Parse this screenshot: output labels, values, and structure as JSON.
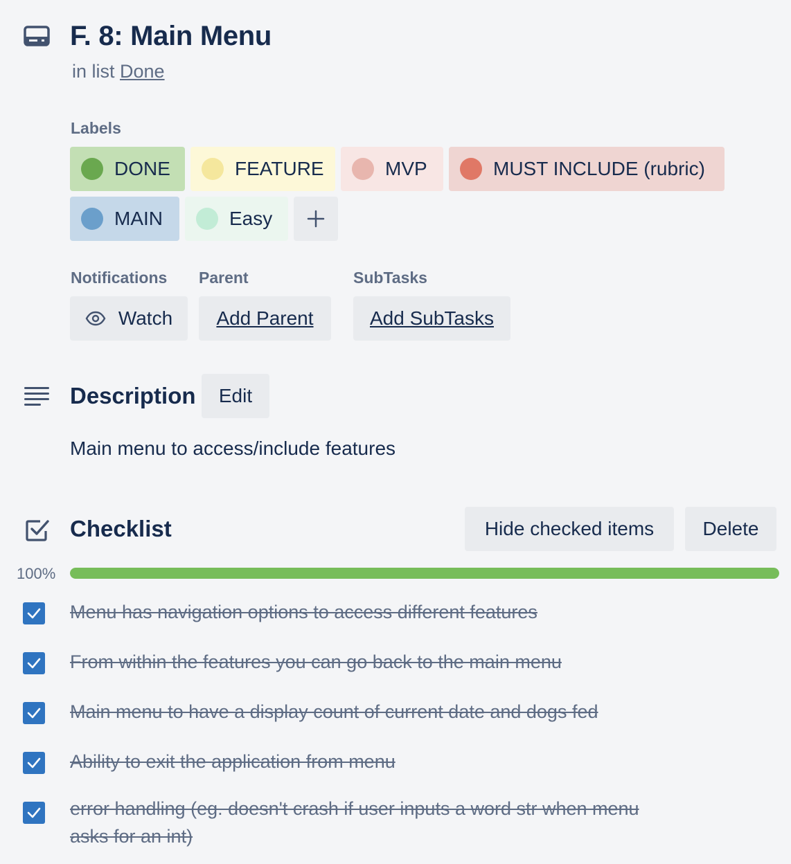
{
  "card": {
    "title": "F. 8: Main Menu",
    "list_prefix": "in list",
    "list_name": "Done"
  },
  "labels": {
    "heading": "Labels",
    "items": [
      {
        "name": "DONE",
        "bg": "#c3dfb4",
        "dot": "#6aa84f"
      },
      {
        "name": "FEATURE",
        "bg": "#fdf8d8",
        "dot": "#f5e79d"
      },
      {
        "name": "MVP",
        "bg": "#f8e6e4",
        "dot": "#e8b6ae"
      },
      {
        "name": "MUST INCLUDE (rubric)",
        "bg": "#efd5d2",
        "dot": "#e07866"
      },
      {
        "name": "MAIN",
        "bg": "#c5d8e9",
        "dot": "#6b9fcb"
      },
      {
        "name": "Easy",
        "bg": "#ebf6ef",
        "dot": "#c2ecd6"
      }
    ],
    "add_icon": "plus-icon"
  },
  "notifications": {
    "heading": "Notifications",
    "watch_label": "Watch",
    "icon": "eye-icon"
  },
  "parent": {
    "heading": "Parent",
    "button_label": "Add Parent"
  },
  "subtasks": {
    "heading": "SubTasks",
    "button_label": "Add SubTasks"
  },
  "description": {
    "heading": "Description",
    "edit_label": "Edit",
    "text": "Main menu to access/include features"
  },
  "checklist": {
    "heading": "Checklist",
    "hide_label": "Hide checked items",
    "delete_label": "Delete",
    "progress_text": "100%",
    "progress": 1.0,
    "items": [
      {
        "text": "Menu has navigation options to access different features",
        "checked": true
      },
      {
        "text": "From within the features you can go back to the main menu",
        "checked": true
      },
      {
        "text": "Main menu to have a display count of current date and dogs fed",
        "checked": true
      },
      {
        "text": "Ability to exit the application from menu",
        "checked": true
      },
      {
        "text": "error handling (eg. doesn't crash if user inputs a word str when menu asks for an int)",
        "checked": true
      }
    ]
  },
  "colors": {
    "accent": "#2f74c0",
    "progress": "#77bd5a",
    "text": "#172b4d",
    "muted": "#5e6c84"
  }
}
